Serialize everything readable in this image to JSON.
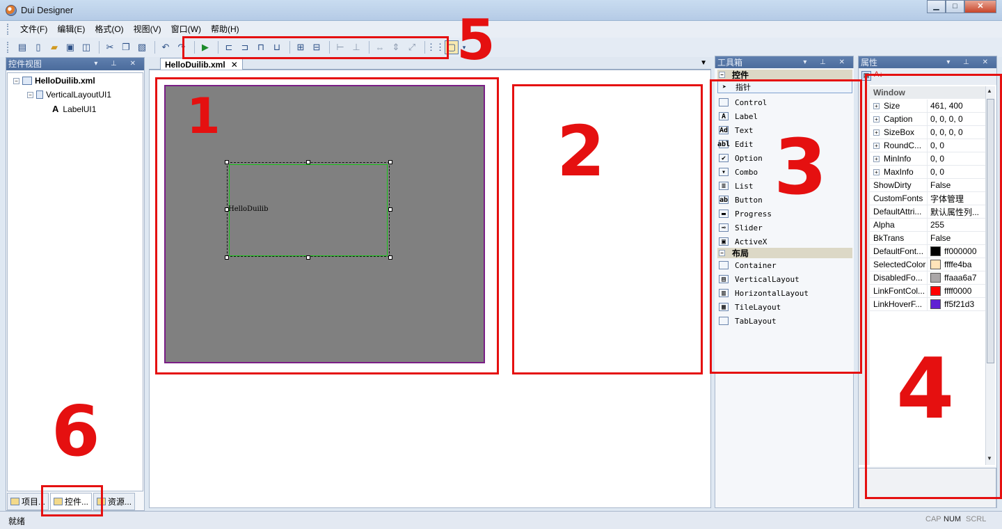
{
  "app": {
    "title": "Dui Designer"
  },
  "menu": [
    "文件(F)",
    "编辑(E)",
    "格式(O)",
    "视图(V)",
    "窗口(W)",
    "帮助(H)"
  ],
  "left_panel": {
    "title": "控件视图",
    "tree": [
      {
        "label": "HelloDuilib.xml",
        "bold": true
      },
      {
        "label": "VerticalLayoutUI1"
      },
      {
        "label": "LabelUI1"
      }
    ],
    "tabs": [
      "项目...",
      "控件...",
      "资源..."
    ]
  },
  "document": {
    "tab_label": "HelloDuilib.xml",
    "tab_close": "✕",
    "label_text": "HelloDuilib"
  },
  "toolbox": {
    "title": "工具箱",
    "groups": [
      {
        "name": "控件",
        "items": [
          {
            "label": "指针",
            "icon": "pointer-icon",
            "glyph": "➤"
          },
          {
            "label": "Control",
            "icon": "control-icon",
            "glyph": ""
          },
          {
            "label": "Label",
            "icon": "label-icon",
            "glyph": "A"
          },
          {
            "label": "Text",
            "icon": "text-icon",
            "glyph": "Ad"
          },
          {
            "label": "Edit",
            "icon": "edit-icon",
            "glyph": "abl"
          },
          {
            "label": "Option",
            "icon": "option-icon",
            "glyph": "✔"
          },
          {
            "label": "Combo",
            "icon": "combo-icon",
            "glyph": "▾"
          },
          {
            "label": "List",
            "icon": "list-icon",
            "glyph": "≡"
          },
          {
            "label": "Button",
            "icon": "button-icon",
            "glyph": "ab"
          },
          {
            "label": "Progress",
            "icon": "progress-icon",
            "glyph": "▬"
          },
          {
            "label": "Slider",
            "icon": "slider-icon",
            "glyph": "⊸"
          },
          {
            "label": "ActiveX",
            "icon": "activex-icon",
            "glyph": "▣"
          }
        ]
      },
      {
        "name": "布局",
        "items": [
          {
            "label": "Container",
            "icon": "container-icon",
            "glyph": ""
          },
          {
            "label": "VerticalLayout",
            "icon": "vertical-layout-icon",
            "glyph": "▤"
          },
          {
            "label": "HorizontalLayout",
            "icon": "horizontal-layout-icon",
            "glyph": "▥"
          },
          {
            "label": "TileLayout",
            "icon": "tile-layout-icon",
            "glyph": "▦"
          },
          {
            "label": "TabLayout",
            "icon": "tab-layout-icon",
            "glyph": ""
          }
        ]
      }
    ]
  },
  "properties": {
    "title": "属性",
    "category": "Window",
    "rows": [
      {
        "name": "Size",
        "value": "461, 400",
        "expandable": true
      },
      {
        "name": "Caption",
        "value": "0, 0, 0, 0",
        "expandable": true
      },
      {
        "name": "SizeBox",
        "value": "0, 0, 0, 0",
        "expandable": true
      },
      {
        "name": "RoundC...",
        "value": "0, 0",
        "expandable": true
      },
      {
        "name": "MinInfo",
        "value": "0, 0",
        "expandable": true
      },
      {
        "name": "MaxInfo",
        "value": "0, 0",
        "expandable": true
      },
      {
        "name": "ShowDirty",
        "value": "False"
      },
      {
        "name": "CustomFonts",
        "value": "字体管理"
      },
      {
        "name": "DefaultAttri...",
        "value": "默认属性列..."
      },
      {
        "name": "Alpha",
        "value": "255"
      },
      {
        "name": "BkTrans",
        "value": "False"
      },
      {
        "name": "DefaultFont...",
        "value": "ff000000",
        "color": "#000000"
      },
      {
        "name": "SelectedColor",
        "value": "ffffe4ba",
        "color": "#ffe4ba"
      },
      {
        "name": "DisabledFo...",
        "value": "ffaaa6a7",
        "color": "#aaa6a7"
      },
      {
        "name": "LinkFontCol...",
        "value": "ffff0000",
        "color": "#ff0000"
      },
      {
        "name": "LinkHoverF...",
        "value": "ff5f21d3",
        "color": "#5f21d3"
      }
    ]
  },
  "status": {
    "text": "就绪",
    "indicators": [
      "CAP",
      "NUM",
      "SCRL"
    ],
    "active": "NUM"
  },
  "annotations": [
    "1",
    "2",
    "3",
    "4",
    "5",
    "6"
  ],
  "colors": {
    "annotation": "#e51010",
    "window_bg": "#808080",
    "window_border": "#7a1e86",
    "label_border": "#16c416"
  }
}
